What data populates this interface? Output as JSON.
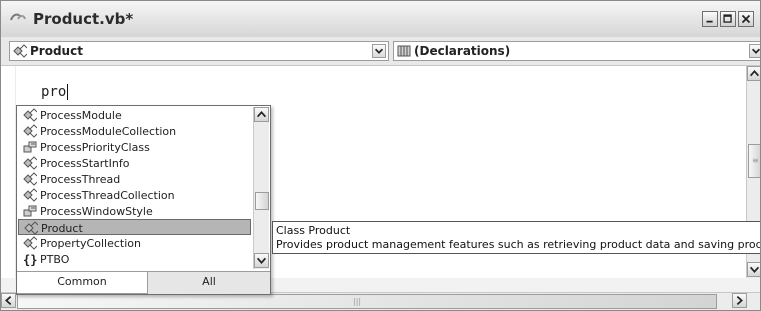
{
  "window": {
    "title": "Product.vb*",
    "title_icon": "vb-document-icon",
    "minimize_icon": "minimize-icon",
    "maximize_icon": "maximize-icon",
    "close_icon": "close-icon"
  },
  "navbar": {
    "class_combo": {
      "label": "Product",
      "icon": "class-icon"
    },
    "member_combo": {
      "label": "(Declarations)",
      "icon": "declarations-icon"
    }
  },
  "editor": {
    "code_text": "pro"
  },
  "completion": {
    "items": [
      {
        "label": "ProcessModule",
        "icon": "class-icon"
      },
      {
        "label": "ProcessModuleCollection",
        "icon": "class-icon"
      },
      {
        "label": "ProcessPriorityClass",
        "icon": "enum-icon"
      },
      {
        "label": "ProcessStartInfo",
        "icon": "class-icon"
      },
      {
        "label": "ProcessThread",
        "icon": "class-icon"
      },
      {
        "label": "ProcessThreadCollection",
        "icon": "class-icon"
      },
      {
        "label": "ProcessWindowStyle",
        "icon": "enum-icon"
      },
      {
        "label": "Product",
        "icon": "class-icon"
      },
      {
        "label": "PropertyCollection",
        "icon": "class-icon"
      },
      {
        "label": "PTBO",
        "icon": "namespace-icon"
      }
    ],
    "selected_item": "Product",
    "tabs": [
      {
        "label": "Common",
        "active": true
      },
      {
        "label": "All",
        "active": false
      }
    ]
  },
  "tooltip": {
    "line1": "Class Product",
    "line2": "Provides product management features such as retrieving product data and saving product changes"
  },
  "colors": {
    "selection": "#b5b5b5",
    "window_bg": "#f2f2f2",
    "title_bg": "#e0e0e0"
  }
}
